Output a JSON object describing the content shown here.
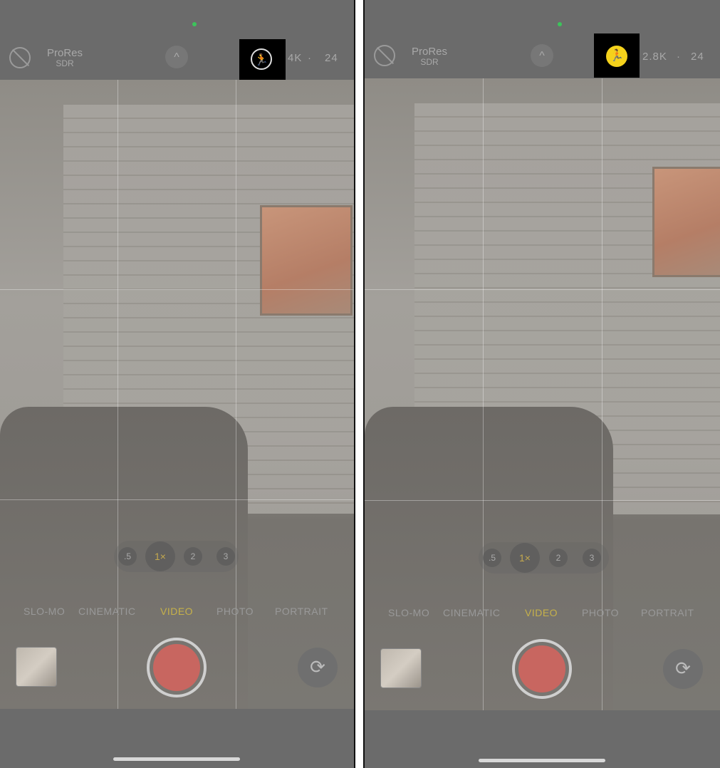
{
  "panels": [
    {
      "prores": "ProRes",
      "prores_sub": "SDR",
      "chevron": "^",
      "action_mode": {
        "state": "off",
        "icon": "action-mode-off-icon",
        "color": "#000000",
        "glyph": "🏃"
      },
      "resolution": "4K",
      "separator": "·",
      "fps": "24",
      "zoom_levels": [
        ".5",
        "1×",
        "2",
        "3"
      ],
      "modes": [
        "SLO-MO",
        "CINEMATIC",
        "VIDEO",
        "PHOTO",
        "PORTRAIT"
      ],
      "active_mode": "VIDEO",
      "flip_glyph": "⟳"
    },
    {
      "prores": "ProRes",
      "prores_sub": "SDR",
      "chevron": "^",
      "action_mode": {
        "state": "on",
        "icon": "action-mode-on-icon",
        "color": "#f5d21c",
        "glyph": "🏃"
      },
      "resolution": "2.8K",
      "separator": "·",
      "fps": "24",
      "zoom_levels": [
        ".5",
        "1×",
        "2",
        "3"
      ],
      "modes": [
        "SLO-MO",
        "CINEMATIC",
        "VIDEO",
        "PHOTO",
        "PORTRAIT"
      ],
      "active_mode": "VIDEO",
      "flip_glyph": "⟳"
    }
  ],
  "colors": {
    "accent": "#c6b14a",
    "record": "#c86660",
    "action_on": "#f5d21c"
  }
}
